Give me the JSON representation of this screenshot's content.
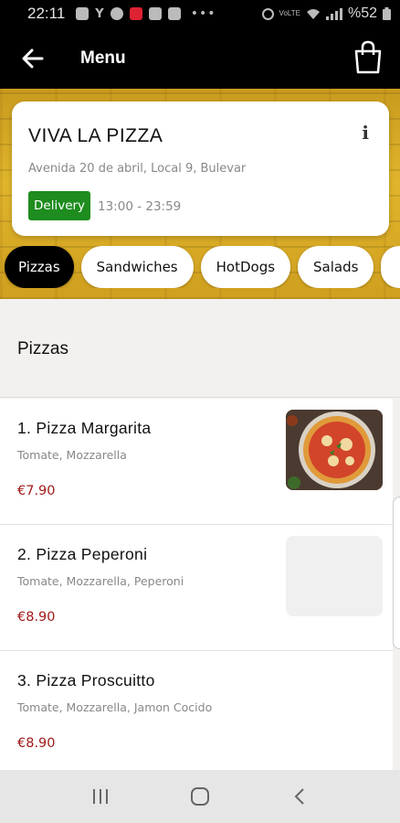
{
  "status_bar": {
    "time": "22:11",
    "battery": "%52",
    "icons": [
      "message-icon",
      "signal-y-icon",
      "facebook-icon",
      "app-icon",
      "box-icon",
      "box-icon",
      "alarm-icon",
      "volte-icon",
      "wifi-icon",
      "cell-signal-icon",
      "battery-icon"
    ]
  },
  "header": {
    "title": "Menu",
    "back_icon": "arrow-left-icon",
    "cart_icon": "shopping-bag-icon"
  },
  "restaurant": {
    "name": "VIVA LA PIZZA",
    "address": "Avenida 20 de abril, Local 9, Bulevar",
    "badge": "Delivery",
    "hours": "13:00 - 23:59",
    "info_icon": "info-icon",
    "badge_color": "#1e8c1e"
  },
  "categories": [
    {
      "label": "Pizzas",
      "active": true
    },
    {
      "label": "Sandwiches",
      "active": false
    },
    {
      "label": "HotDogs",
      "active": false
    },
    {
      "label": "Salads",
      "active": false
    }
  ],
  "section": {
    "title": "Pizzas"
  },
  "items": [
    {
      "name": "1. Pizza Margarita",
      "desc": "Tomate, Mozzarella",
      "price": "€7.90",
      "has_image": true
    },
    {
      "name": "2. Pizza Peperoni",
      "desc": "Tomate, Mozzarella, Peperoni",
      "price": "€8.90",
      "has_image": false
    },
    {
      "name": "3. Pizza Proscuitto",
      "desc": "Tomate, Mozzarella, Jamon Cocido",
      "price": "€8.90",
      "has_image": false
    }
  ],
  "colors": {
    "accent": "#000000",
    "price": "#a11a1a",
    "hero": "#e0b52c"
  },
  "nav": [
    "recent-apps-icon",
    "home-icon",
    "back-icon"
  ]
}
